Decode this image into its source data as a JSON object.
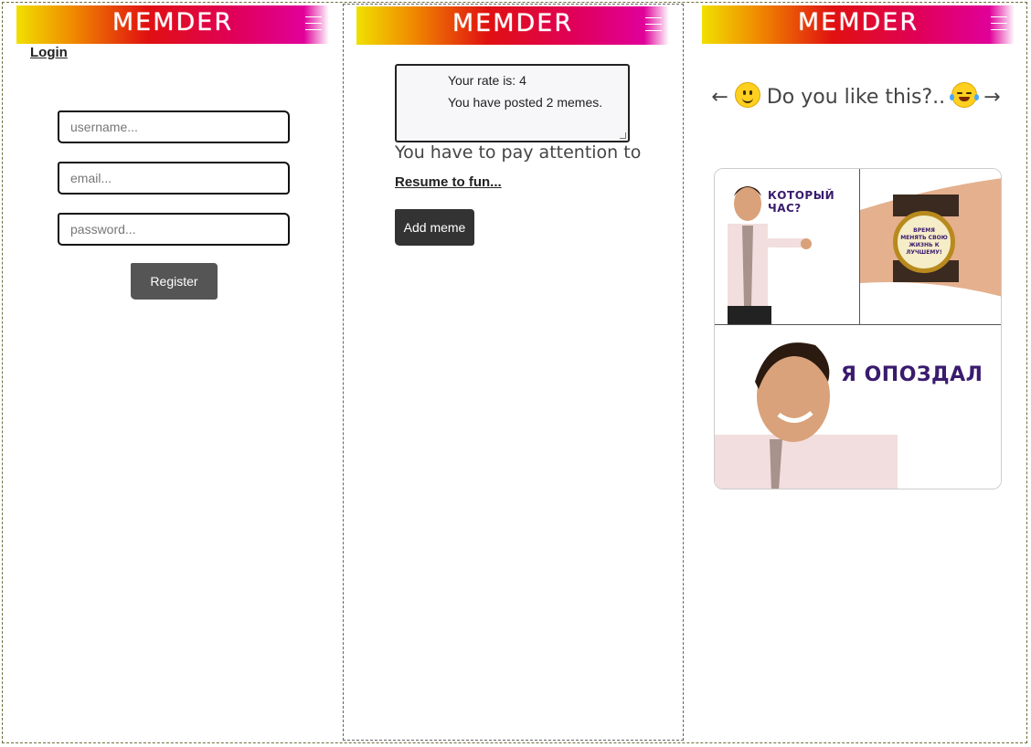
{
  "brand": "MEMDER",
  "panel1": {
    "login_link": "Login",
    "username_placeholder": "username...",
    "email_placeholder": "email...",
    "password_placeholder": "password...",
    "register_label": "Register"
  },
  "panel2": {
    "rate_text": "Your rate is: 4",
    "posted_text": "You have posted 2 memes.",
    "attention_text": "You have to pay attention to",
    "resume_link": "Resume to fun...",
    "add_meme_label": "Add meme"
  },
  "panel3": {
    "arrow_left": "←",
    "question": "Do you like this?..",
    "arrow_right": "→",
    "meme": {
      "caption_top": "КОТОРЫЙ ЧАС?",
      "caption_watch": "ВРЕМЯ МЕНЯТЬ СВОЮ ЖИЗНЬ К ЛУЧШЕМУ!",
      "caption_bottom": "Я ОПОЗДАЛ"
    }
  },
  "colors": {
    "header_gradient": [
      "#f0e000",
      "#e01010",
      "#e0009a"
    ],
    "button_dark": "#555555",
    "caption_purple": "#3a1b6e"
  },
  "icons": [
    "hamburger-menu-icon",
    "smile-emoji-icon",
    "laughing-tears-emoji-icon"
  ]
}
